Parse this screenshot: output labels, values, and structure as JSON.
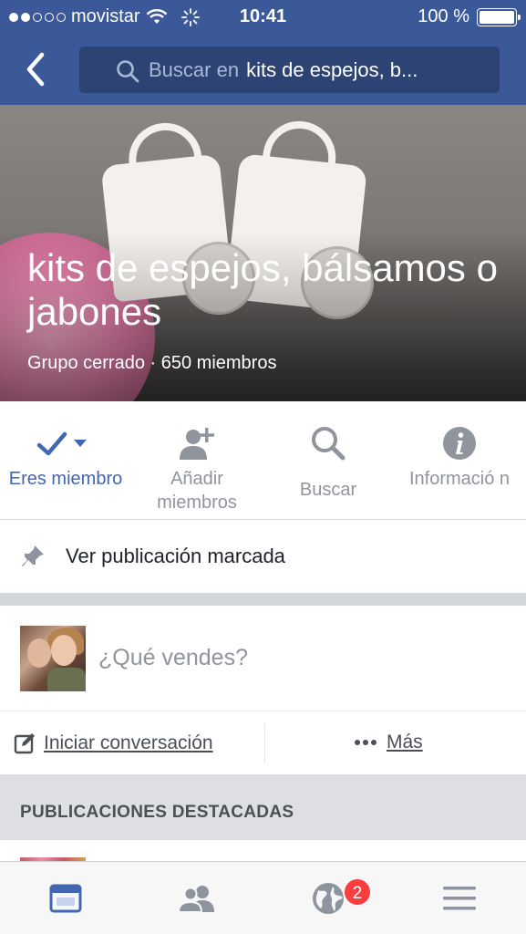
{
  "status_bar": {
    "carrier": "movistar",
    "time": "10:41",
    "battery": "100 %"
  },
  "header": {
    "search_placeholder": "Buscar en",
    "search_query": "kits de espejos, b..."
  },
  "group": {
    "name": "kits de espejos, bálsamos o jabones",
    "meta": "Grupo cerrado · 650 miembros"
  },
  "actions": [
    {
      "label": "Eres miembro",
      "icon": "checkmark-dropdown-icon"
    },
    {
      "label": "Añadir miembros",
      "icon": "add-person-icon"
    },
    {
      "label": "Buscar",
      "icon": "search-icon"
    },
    {
      "label": "Informació n",
      "icon": "info-icon"
    }
  ],
  "pinned": {
    "label": "Ver publicación marcada",
    "icon": "pin-icon"
  },
  "composer": {
    "prompt": "¿Qué vendes?"
  },
  "composer_actions": {
    "start": "Iniciar conversación",
    "more": "Más"
  },
  "featured_header": "PUBLICACIONES DESTACADAS",
  "tabbar": {
    "tabs": [
      "news-feed-icon",
      "friends-icon",
      "globe-icon",
      "menu-icon"
    ],
    "notifications_badge": "2"
  },
  "colors": {
    "brand": "#3b5998",
    "accent": "#4267b2",
    "muted": "#90949c",
    "badge": "#fa3e3e"
  }
}
